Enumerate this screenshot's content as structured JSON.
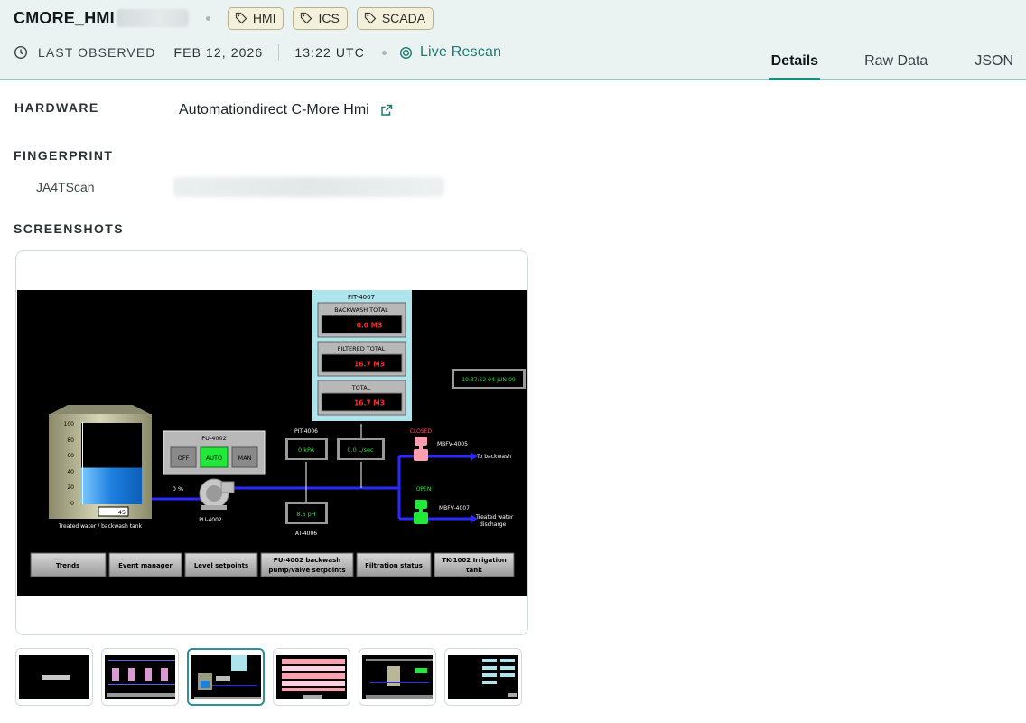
{
  "header": {
    "hostname": "CMORE_HMI",
    "tags": [
      "HMI",
      "ICS",
      "SCADA"
    ],
    "last_observed_label": "LAST OBSERVED",
    "date": "FEB 12, 2026",
    "time": "13:22 UTC",
    "rescan_label": "Live Rescan",
    "tabs": [
      "Details",
      "Raw Data",
      "JSON"
    ],
    "active_tab": "Details"
  },
  "sections": {
    "hardware_label": "HARDWARE",
    "hardware_value": "Automationdirect C-More Hmi",
    "fingerprint_label": "FINGERPRINT",
    "fingerprint_key": "JA4TScan",
    "screenshots_label": "SCREENSHOTS"
  },
  "hmi": {
    "fit_title": "FIT-4007",
    "backwash_total_label": "BACKWASH TOTAL",
    "backwash_total_value": "0.0 M3",
    "filtered_total_label": "FILTERED TOTAL",
    "filtered_total_value": "16.7 M3",
    "total_label": "TOTAL",
    "total_value": "16.7 M3",
    "clock": "19:37:52 04-JUN-09",
    "tank_scale": [
      "100",
      "80",
      "60",
      "40",
      "20",
      "0"
    ],
    "tank_level_value": "45",
    "tank_level_fraction": 0.45,
    "tank_caption": "Treated water / backwash tank",
    "pump_panel_title": "PU-4002",
    "pump_modes": [
      "OFF",
      "AUTO",
      "MAN"
    ],
    "pump_active_mode": "AUTO",
    "pump_speed": "0 %",
    "pump_label": "PU-4002",
    "pit_label": "PIT-4006",
    "pit_value": "0 kPA",
    "flow_value": "0.0 L/sec",
    "ph_value": "8.6 pH",
    "at_label": "AT-4006",
    "valve1_state": "CLOSED",
    "valve1_label": "MBFV-4005",
    "valve1_dest": "To backwash",
    "valve2_state": "OPEN",
    "valve2_label": "MBFV-4007",
    "valve2_dest_line1": "Treated water",
    "valve2_dest_line2": "discharge",
    "nav_buttons": [
      {
        "line1": "Trends",
        "line2": ""
      },
      {
        "line1": "Event manager",
        "line2": ""
      },
      {
        "line1": "Level setpoints",
        "line2": ""
      },
      {
        "line1": "PU-4002 backwash",
        "line2": "pump/valve setpoints"
      },
      {
        "line1": "Filtration status",
        "line2": ""
      },
      {
        "line1": "TK-1002 Irrigation",
        "line2": "tank"
      }
    ]
  },
  "thumbnails": {
    "count": 6,
    "active_index": 2
  },
  "colors": {
    "accent": "#1e8b80",
    "header_bg": "#eaf3f2",
    "tag_bg": "#f3f0dc",
    "hmi_pipe": "#2a2aff",
    "hmi_green": "#22e83a",
    "hmi_red_value": "#ff2a2a"
  }
}
